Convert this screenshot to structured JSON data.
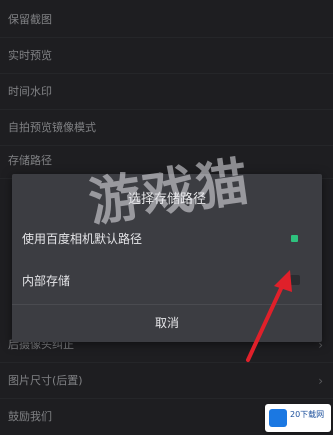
{
  "settings": {
    "rows": [
      {
        "label": "保留截图"
      },
      {
        "label": "实时预览"
      },
      {
        "label": "时间水印"
      },
      {
        "label": "自拍预览镜像模式"
      },
      {
        "label": "存储路径"
      },
      {
        "label": ""
      },
      {
        "label": ""
      },
      {
        "label": ""
      },
      {
        "label": ""
      },
      {
        "label": "后摄像头纠正"
      },
      {
        "label": "图片尺寸(后置)"
      },
      {
        "label": "鼓励我们"
      }
    ]
  },
  "dialog": {
    "title": "选择存储路径",
    "options": [
      {
        "label": "使用百度相机默认路径",
        "selected": true
      },
      {
        "label": "内部存储",
        "selected": false
      }
    ],
    "cancel_label": "取消"
  },
  "watermark": {
    "text": "游戏猫"
  },
  "badge": {
    "text": "20下载网"
  },
  "colors": {
    "background": "#2e2f33",
    "dialog": "#3c3d42",
    "selected_radio": "#2ec27e",
    "arrow": "#e0202a"
  }
}
